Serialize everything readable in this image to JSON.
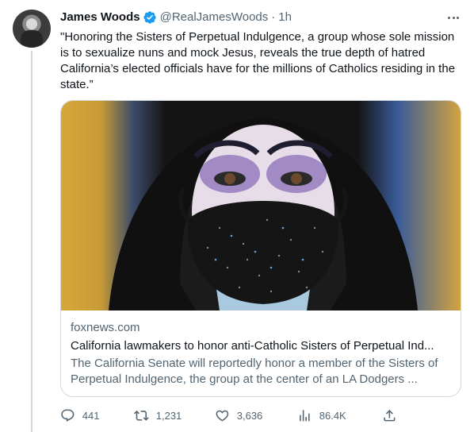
{
  "tweet": {
    "author_name": "James Woods",
    "handle": "@RealJamesWoods",
    "separator": "·",
    "time": "1h",
    "text": "\"Honoring the Sisters of Perpetual Indulgence, a group whose sole mission is to sexualize nuns and mock Jesus, reveals the true depth of hatred California’s elected officials have for the millions of Catholics residing in the state.”"
  },
  "card": {
    "domain": "foxnews.com",
    "title": "California lawmakers to honor anti-Catholic Sisters of Perpetual Ind...",
    "description": "The California Senate will reportedly honor a member of the Sisters of Perpetual Indulgence, the group at the center of an LA Dodgers ..."
  },
  "actions": {
    "replies": "441",
    "retweets": "1,231",
    "likes": "3,636",
    "views": "86.4K"
  },
  "icons": {
    "verified": "verified-badge-icon",
    "more": "more-dots-icon",
    "reply": "reply-icon",
    "retweet": "retweet-icon",
    "like": "heart-icon",
    "views": "views-chart-icon",
    "share": "share-icon"
  },
  "colors": {
    "verified_blue": "#1d9bf0",
    "secondary_text": "#536471",
    "primary_text": "#0f1419",
    "border": "#cfd9de"
  }
}
